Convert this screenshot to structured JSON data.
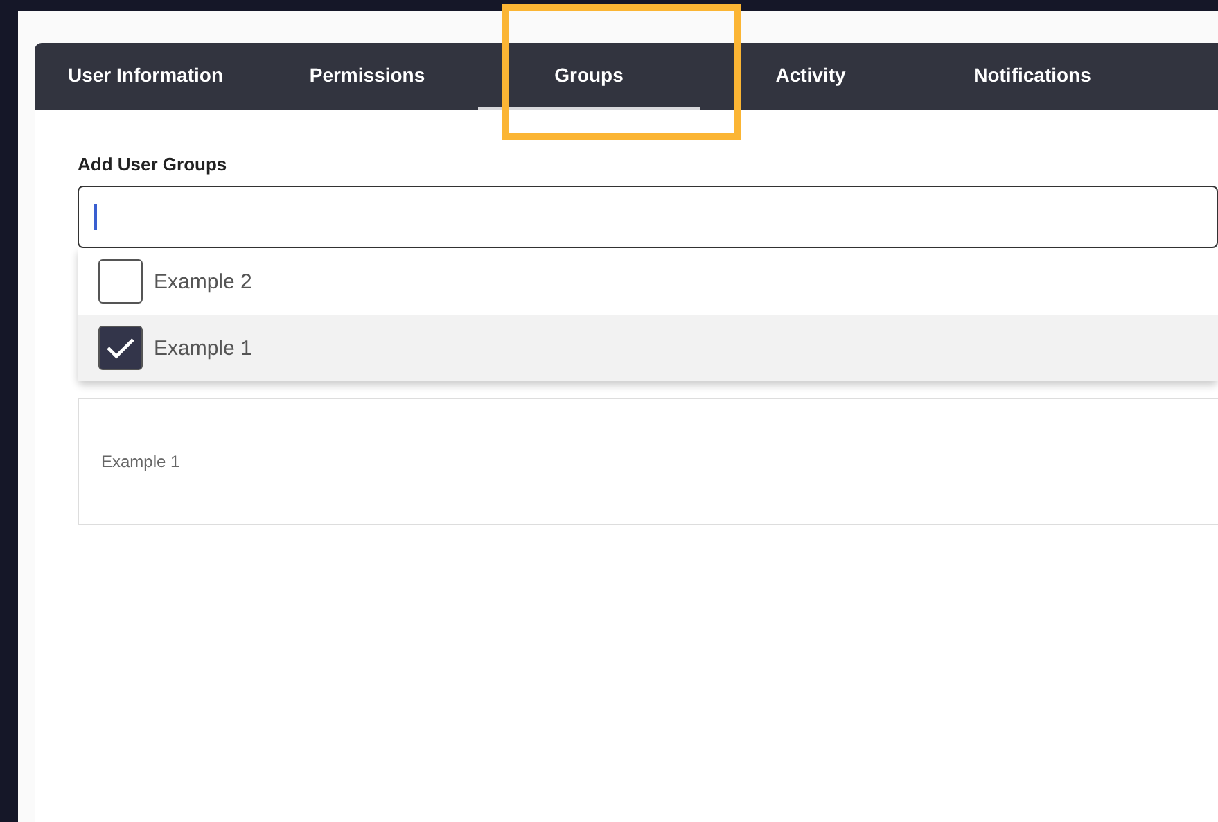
{
  "tabs": [
    {
      "label": "User Information",
      "selected": false
    },
    {
      "label": "Permissions",
      "selected": false
    },
    {
      "label": "Groups",
      "selected": true
    },
    {
      "label": "Activity",
      "selected": false
    },
    {
      "label": "Notifications",
      "selected": false
    }
  ],
  "groups_field": {
    "label": "Add User Groups"
  },
  "options": [
    {
      "label": "Example 2",
      "checked": false
    },
    {
      "label": "Example 1",
      "checked": true
    }
  ],
  "selected_groups": [
    {
      "label": "Example 1"
    }
  ]
}
